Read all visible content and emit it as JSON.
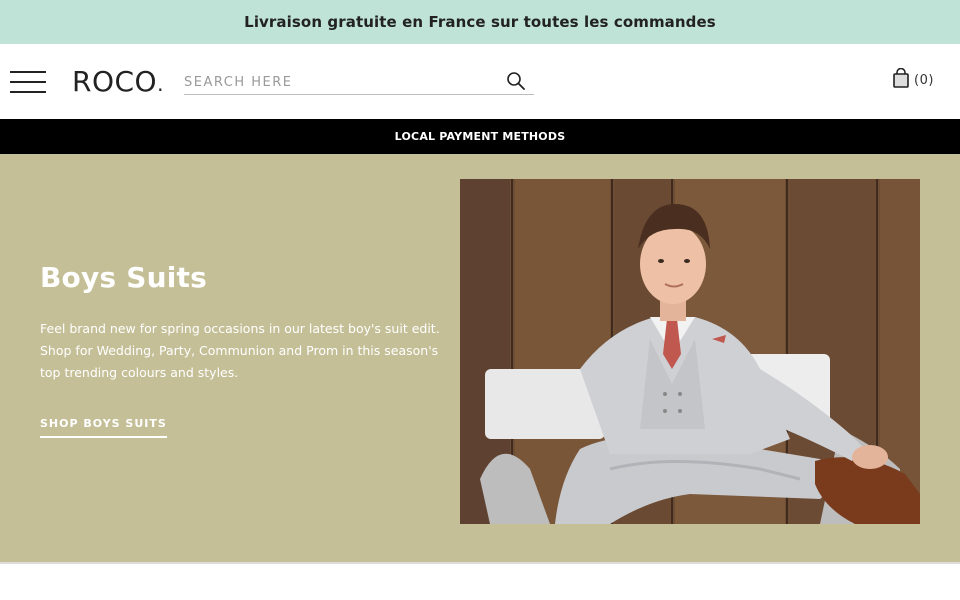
{
  "promo": {
    "text": "Livraison gratuite en France sur toutes les commandes"
  },
  "header": {
    "logo": "ROCO",
    "search_placeholder": "SEARCH HERE",
    "cart_count": "(0)"
  },
  "payment_bar": {
    "text": "LOCAL PAYMENT METHODS"
  },
  "hero": {
    "title": "Boys Suits",
    "description": "Feel brand new for spring occasions in our latest boy's suit edit. Shop for Wedding, Party, Communion and Prom in this season's top trending colours and styles.",
    "cta_label": "SHOP BOYS SUITS"
  },
  "icons": {
    "menu": "hamburger-menu-icon",
    "search": "search-icon",
    "cart": "shopping-bag-icon"
  },
  "colors": {
    "promo_bg": "#bfe3d6",
    "hero_bg": "#c4bf97",
    "payment_bar_bg": "#000000"
  }
}
